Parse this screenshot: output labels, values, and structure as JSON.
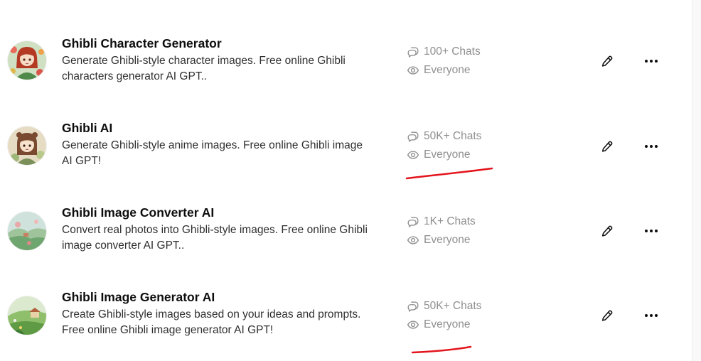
{
  "gpts": [
    {
      "title": "Ghibli Character Generator",
      "description": "Generate Ghibli-style character images. Free online Ghibli characters generator AI GPT..",
      "chats": "100+ Chats",
      "visibility": "Everyone",
      "avatar_icon": "anime-girl-red-hair-avatar-icon"
    },
    {
      "title": "Ghibli AI",
      "description": "Generate Ghibli-style anime images. Free online Ghibli image AI GPT!",
      "chats": "50K+ Chats",
      "visibility": "Everyone",
      "avatar_icon": "anime-girl-brown-hair-avatar-icon"
    },
    {
      "title": "Ghibli Image Converter AI",
      "description": "Convert real photos into Ghibli-style images. Free online Ghibli image converter AI GPT..",
      "chats": "1K+ Chats",
      "visibility": "Everyone",
      "avatar_icon": "landscape-hills-avatar-icon"
    },
    {
      "title": "Ghibli Image Generator AI",
      "description": "Create Ghibli-style images based on your ideas and prompts. Free online Ghibli image generator AI GPT!",
      "chats": "50K+ Chats",
      "visibility": "Everyone",
      "avatar_icon": "meadow-house-avatar-icon"
    }
  ],
  "icons": {
    "chats": "chat-bubbles-icon",
    "visibility": "eye-icon",
    "edit": "pencil-icon",
    "more": "more-horizontal-icon"
  },
  "colors": {
    "title": "#0d0d0d",
    "description": "#2f2f2f",
    "stats": "#8f8f8f",
    "annotation": "#e3141c"
  },
  "annotations": [
    {
      "type": "red-underline",
      "row": 1
    },
    {
      "type": "red-underline",
      "row": 3
    }
  ]
}
